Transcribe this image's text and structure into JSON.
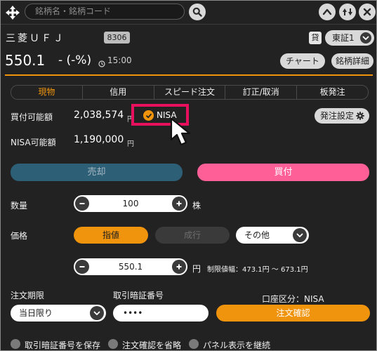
{
  "search": {
    "placeholder": "銘柄名・銘柄コード"
  },
  "stock": {
    "name": "三菱ＵＦＪ",
    "code": "8306",
    "lending_badge": "貸",
    "market": "東証1",
    "price": "550.1",
    "change": "- (-%)",
    "time": "15:00"
  },
  "header_buttons": {
    "chart": "チャート",
    "detail": "銘柄詳細"
  },
  "tabs": [
    {
      "label": "現物",
      "active": true
    },
    {
      "label": "信用",
      "active": false
    },
    {
      "label": "スピード注文",
      "active": false
    },
    {
      "label": "訂正/取消",
      "active": false
    },
    {
      "label": "板発注",
      "active": false
    }
  ],
  "buying_power": {
    "label": "買付可能額",
    "value": "2,038,574",
    "unit": "円"
  },
  "nisa_toggle": {
    "label": "NISA",
    "checked": true
  },
  "nisa_power": {
    "label": "NISA可能額",
    "value": "1,190,000",
    "unit": "円"
  },
  "order_settings": {
    "label": "発注設定"
  },
  "actions": {
    "sell": "売却",
    "buy": "買付"
  },
  "quantity": {
    "label": "数量",
    "value": "100",
    "unit": "株"
  },
  "price_section": {
    "label": "価格",
    "limit": "指値",
    "market": "成行",
    "other": "その他",
    "value": "550.1",
    "unit": "円",
    "range": "制限値幅：473.1円 〜 673.1円"
  },
  "expiry": {
    "label": "注文期限",
    "value": "当日限り"
  },
  "pin": {
    "label": "取引暗証番号",
    "value": "••••"
  },
  "account": {
    "label": "口座区分：NISA"
  },
  "confirm": {
    "label": "注文確認"
  },
  "options": [
    {
      "label": "取引暗証番号を保存"
    },
    {
      "label": "注文確認を省略"
    },
    {
      "label": "パネル表示を継続"
    }
  ],
  "colors": {
    "accent_orange": "#f0940d",
    "buy_pink": "#ff5f97",
    "sell_teal": "#2d5f77",
    "highlight_red": "#e8105c",
    "panel_bg": "#222222"
  }
}
